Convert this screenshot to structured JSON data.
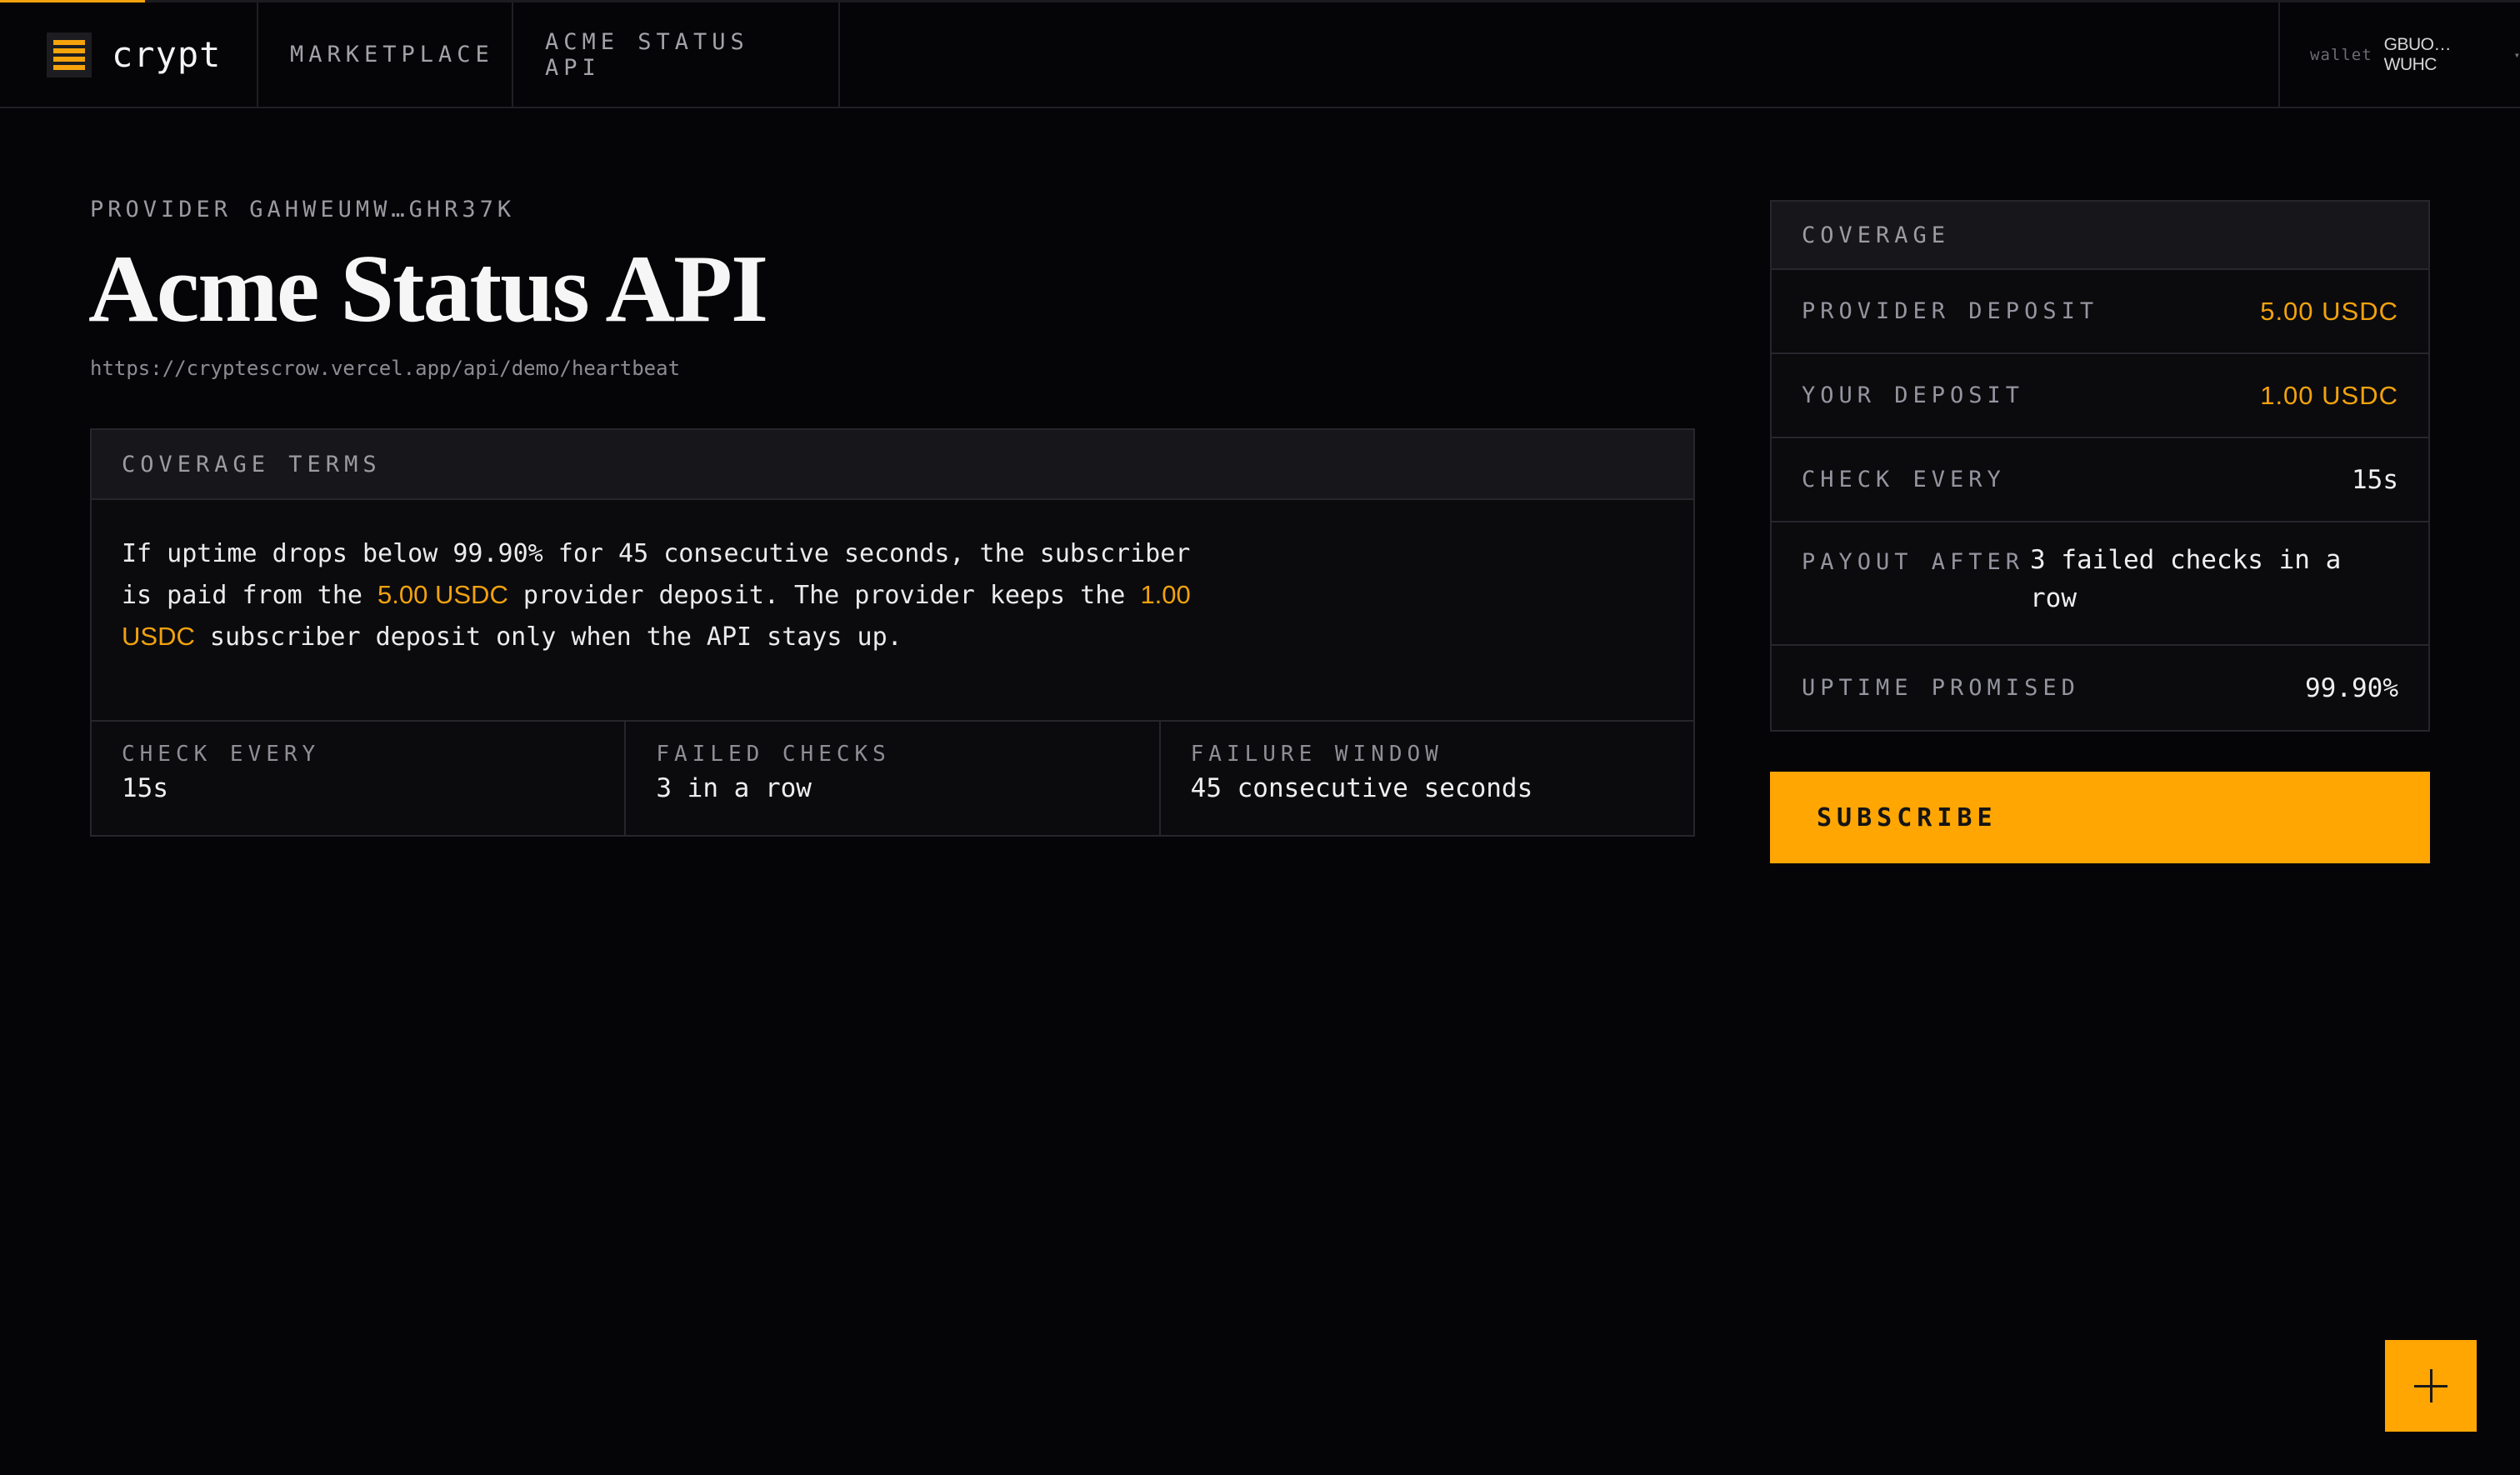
{
  "colors": {
    "accent": "#ffa602",
    "background": "#050507",
    "highlight_text": "#f2a20d"
  },
  "header": {
    "brand": "crypt",
    "logo_icon": "stacked-bars-logo-icon",
    "nav": [
      "MARKETPLACE",
      "ACME STATUS API"
    ],
    "wallet_label": "wallet",
    "wallet_address": "GBUO…WUHC",
    "wallet_caret": "▾"
  },
  "main": {
    "eyebrow": "PROVIDER GAHWEUMW…GHR37K",
    "title": "Acme Status API",
    "url": "https://cryptescrow.vercel.app/api/demo/heartbeat"
  },
  "terms": {
    "heading": "COVERAGE TERMS",
    "text_1": "If uptime drops below 99.90% for 45 consecutive seconds, the subscriber is paid from the ",
    "provider_deposit": "5.00 USDC",
    "text_2": " provider deposit. The provider keeps the ",
    "subscriber_deposit": "1.00 USDC",
    "text_3": " subscriber deposit only when the API stays up.",
    "stats": [
      {
        "label": "CHECK EVERY",
        "value": "15s"
      },
      {
        "label": "FAILED CHECKS",
        "value": "3 in a row"
      },
      {
        "label": "FAILURE WINDOW",
        "value": "45 consecutive seconds"
      }
    ]
  },
  "coverage": {
    "heading": "COVERAGE",
    "rows": [
      {
        "label": "PROVIDER DEPOSIT",
        "value": "5.00 USDC"
      },
      {
        "label": "YOUR DEPOSIT",
        "value": "1.00 USDC"
      },
      {
        "label": "CHECK EVERY",
        "value": "15s"
      },
      {
        "label": "PAYOUT AFTER",
        "value": "3 failed checks in a row"
      },
      {
        "label": "UPTIME PROMISED",
        "value": "99.90%"
      }
    ],
    "subscribe_label": "SUBSCRIBE"
  },
  "fab": {
    "icon": "plus-icon"
  }
}
